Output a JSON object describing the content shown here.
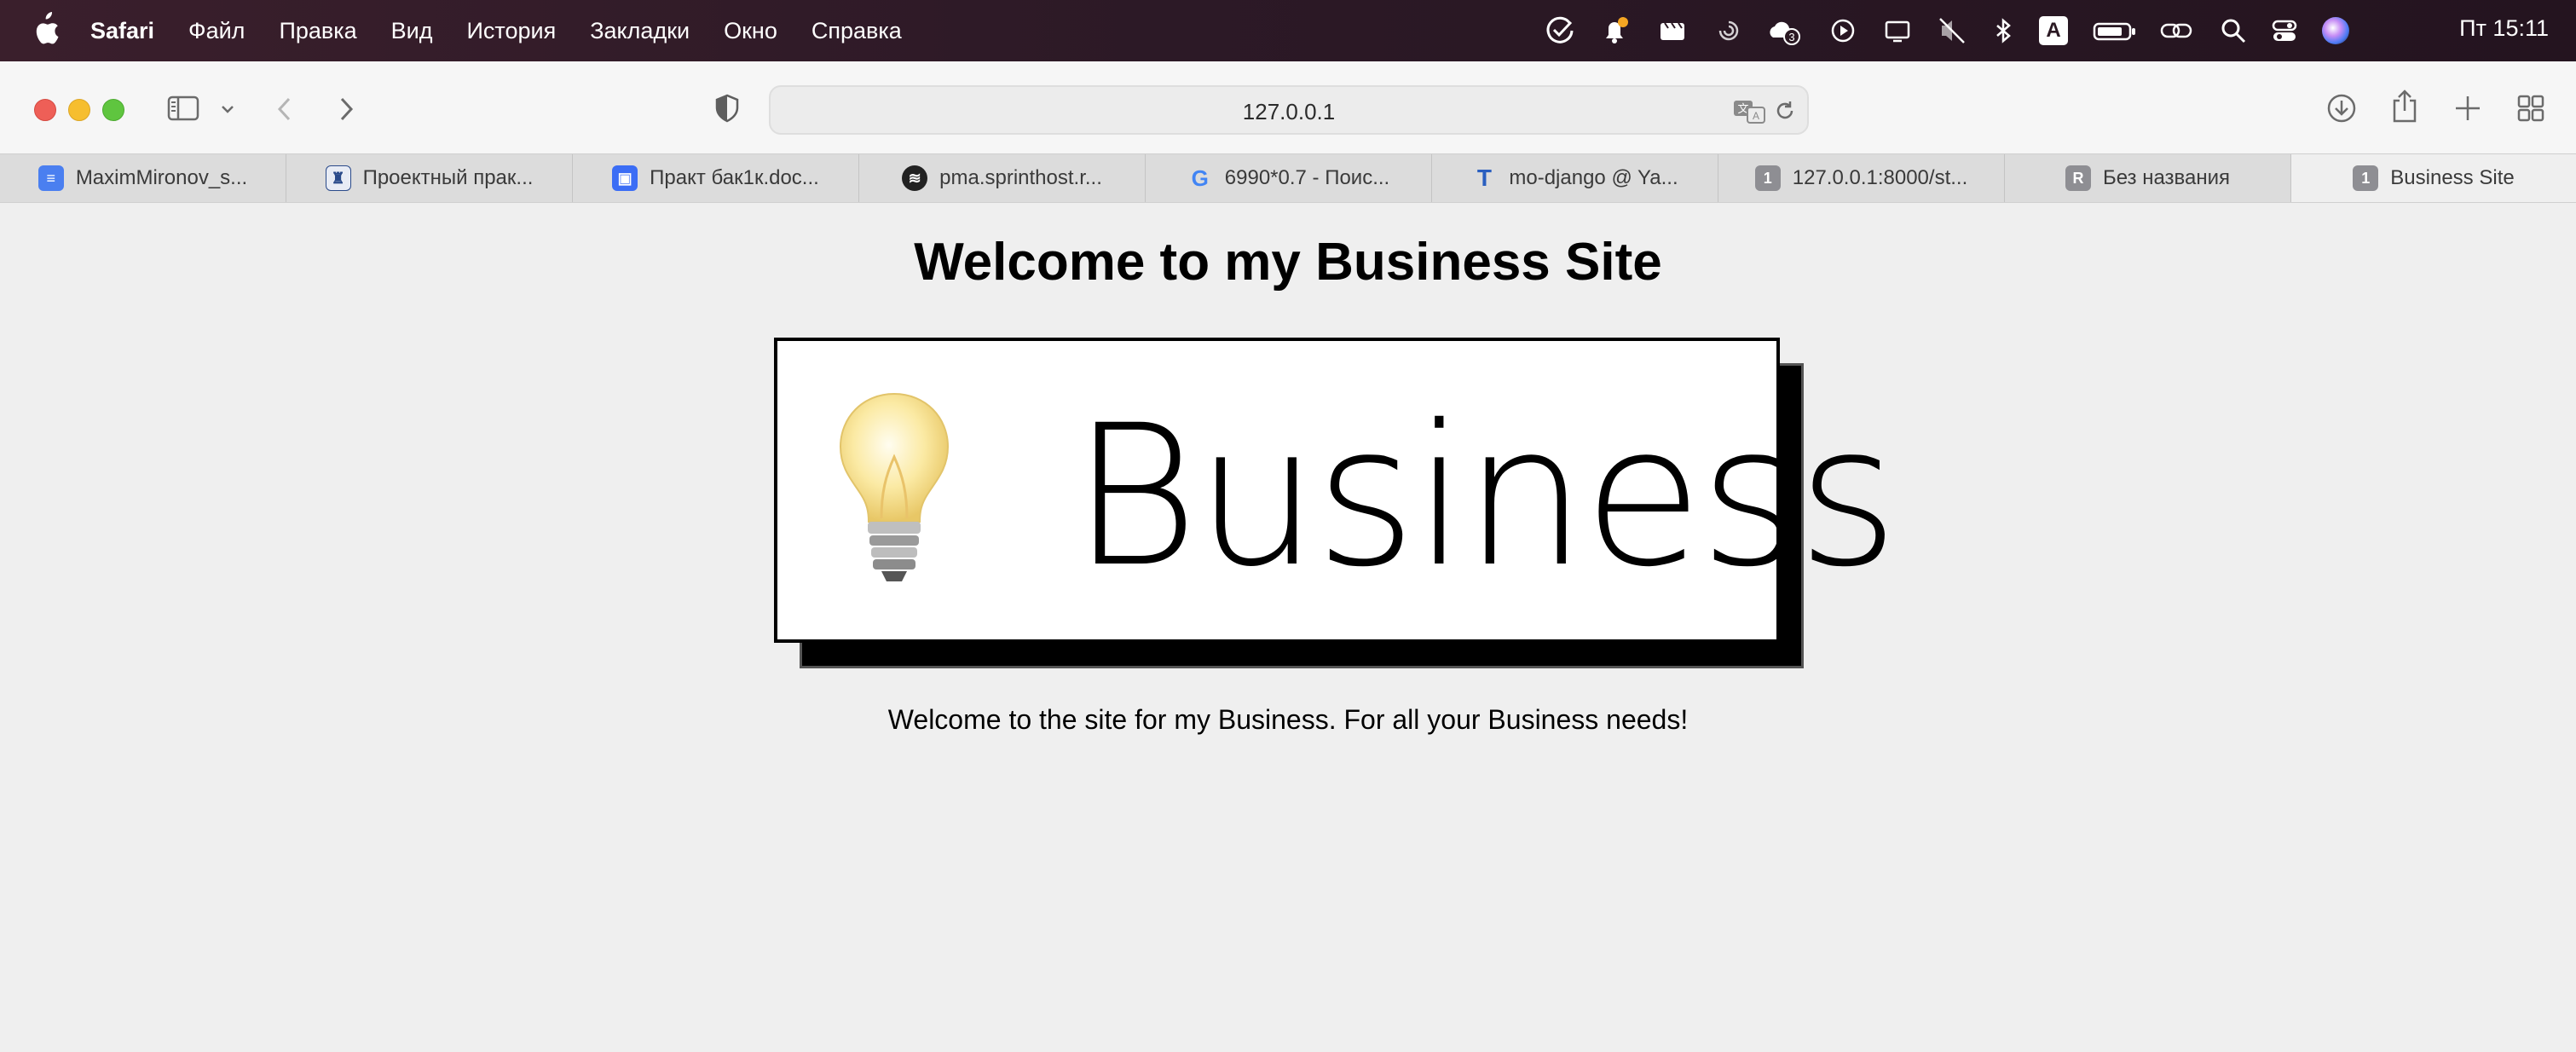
{
  "menubar": {
    "items": [
      "Safari",
      "Файл",
      "Правка",
      "Вид",
      "История",
      "Закладки",
      "Окно",
      "Справка"
    ],
    "clock": "Пт  15:11",
    "notification_count": "3",
    "keyboard_layout": "A"
  },
  "toolbar": {
    "url": "127.0.0.1"
  },
  "tabs": [
    {
      "title": "MaximMironov_s...",
      "icon": "docs-icon",
      "color": "#4a7ff0"
    },
    {
      "title": "Проектный прак...",
      "icon": "crest-icon",
      "color": "#2a4a8a"
    },
    {
      "title": "Практ бак1к.doc...",
      "icon": "cube-icon",
      "color": "#3b6df5"
    },
    {
      "title": "pma.sprinthost.r...",
      "icon": "sprinthost-icon",
      "color": "#222222"
    },
    {
      "title": "6990*0.7 - Поис...",
      "icon": "google-icon",
      "color": "#ffffff"
    },
    {
      "title": "mo-django @ Ya...",
      "icon": "t-icon",
      "color": "#2a5fc0"
    },
    {
      "title": "127.0.0.1:8000/st...",
      "icon": "1",
      "color": "#8e8e93"
    },
    {
      "title": "Без названия",
      "icon": "R",
      "color": "#8e8e93"
    },
    {
      "title": "Business Site",
      "icon": "1",
      "color": "#8e8e93"
    }
  ],
  "page": {
    "heading": "Welcome to my Business Site",
    "logo_text": "Business",
    "body_text": "Welcome to the site for my Business. For all your Business needs!"
  }
}
